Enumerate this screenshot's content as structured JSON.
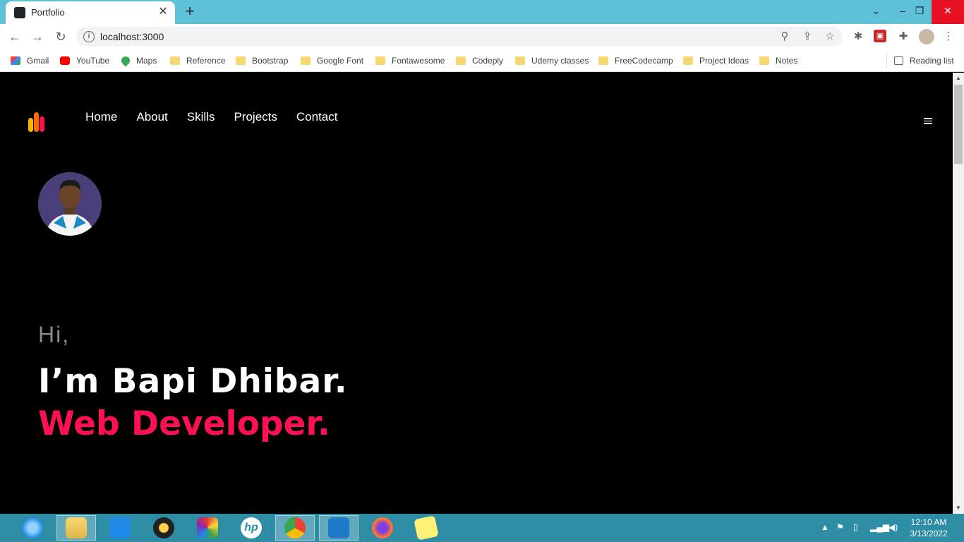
{
  "browser": {
    "tab_title": "Portfolio",
    "url": "localhost:3000",
    "bookmarks": [
      {
        "label": "Gmail",
        "icon": "gmail-icon"
      },
      {
        "label": "YouTube",
        "icon": "youtube-icon"
      },
      {
        "label": "Maps",
        "icon": "maps-icon"
      },
      {
        "label": "Reference",
        "icon": "folder-icon"
      },
      {
        "label": "Bootstrap",
        "icon": "folder-icon"
      },
      {
        "label": "Google Font",
        "icon": "folder-icon"
      },
      {
        "label": "Fontawesome",
        "icon": "folder-icon"
      },
      {
        "label": "Codeply",
        "icon": "folder-icon"
      },
      {
        "label": "Udemy classes",
        "icon": "folder-icon"
      },
      {
        "label": "FreeCodecamp",
        "icon": "folder-icon"
      },
      {
        "label": "Project Ideas",
        "icon": "folder-icon"
      },
      {
        "label": "Notes",
        "icon": "folder-icon"
      }
    ],
    "reading_list": "Reading list"
  },
  "site": {
    "nav": [
      "Home",
      "About",
      "Skills",
      "Projects",
      "Contact"
    ],
    "greeting": "Hi,",
    "name": "I’m Bapi Dhibar.",
    "role": "Web Developer.",
    "colors": {
      "accent": "#ff1053",
      "background": "#000000",
      "greeting": "#8a8a92"
    }
  },
  "taskbar": {
    "time": "12:10 AM",
    "date": "3/13/2022"
  }
}
